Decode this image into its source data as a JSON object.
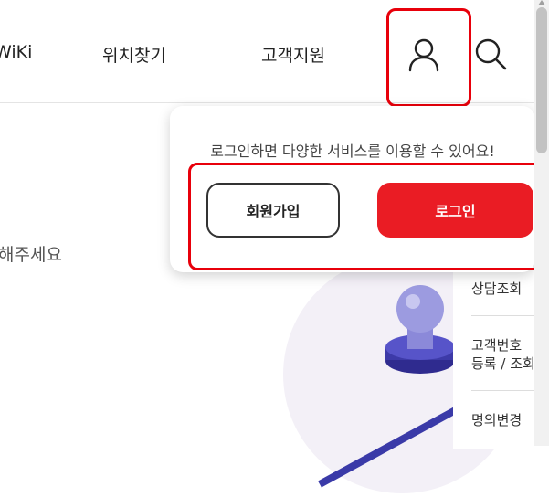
{
  "header": {
    "nav": [
      "WiKi",
      "위치찾기",
      "고객지원"
    ],
    "icons": {
      "user": "user-icon",
      "search": "search-icon"
    }
  },
  "background": {
    "partial_text": "해주세요",
    "right_menu": {
      "items": [
        {
          "lines": [
            "상담조회"
          ]
        },
        {
          "lines": [
            "고객번호",
            "등록 / 조회"
          ]
        },
        {
          "lines": [
            "명의변경"
          ]
        }
      ]
    }
  },
  "popover": {
    "message": "로그인하면 다양한 서비스를 이용할 수 있어요!",
    "signup_label": "회원가입",
    "login_label": "로그인"
  },
  "colors": {
    "accent": "#ea1c24",
    "highlight": "#e8000b"
  }
}
